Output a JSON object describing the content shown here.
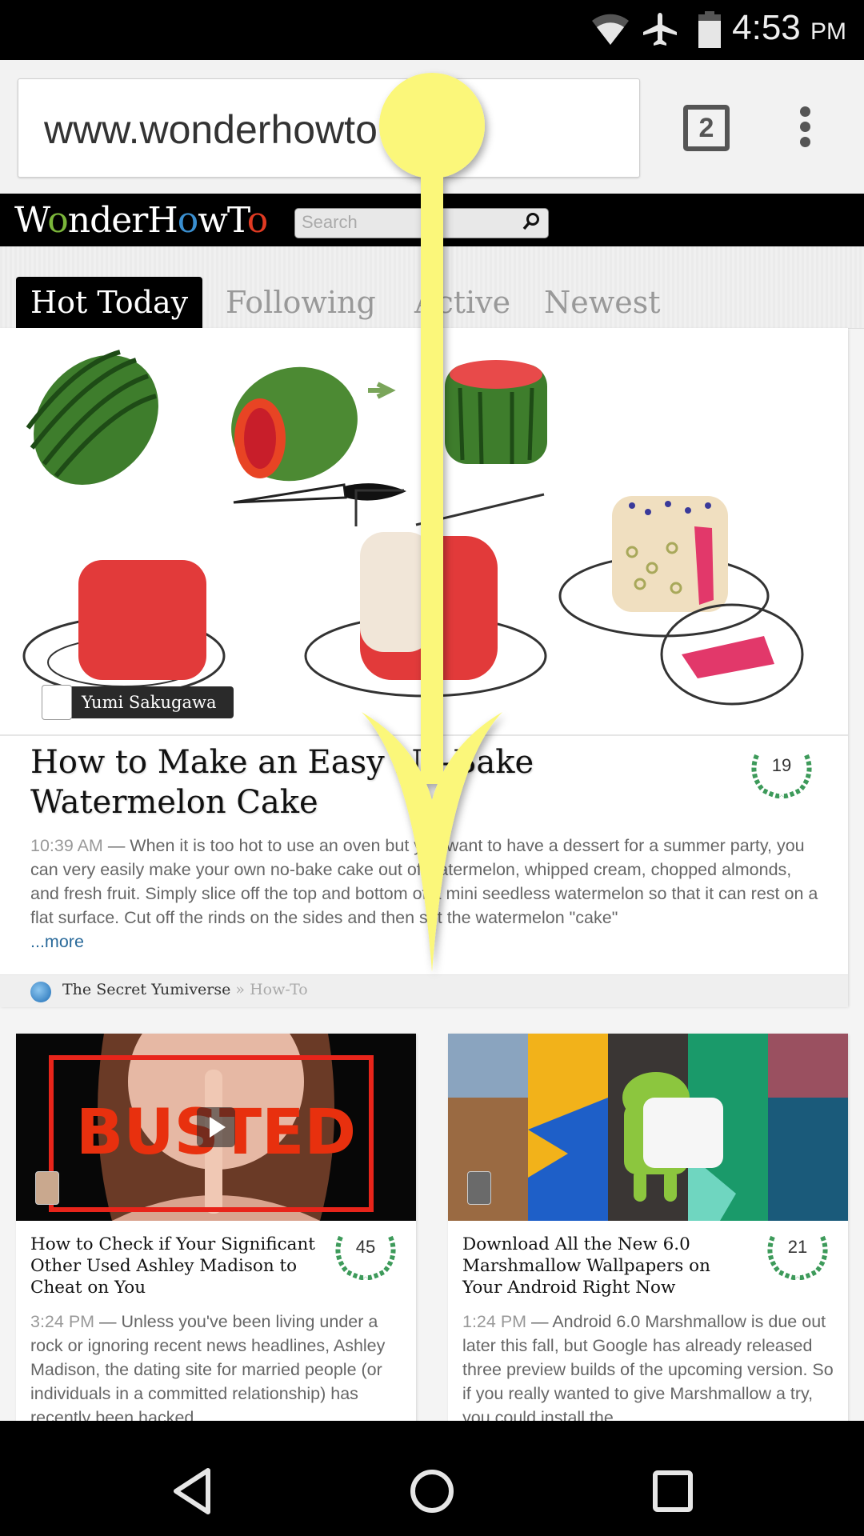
{
  "status_bar": {
    "time": "4:53",
    "ampm": "PM",
    "icons": [
      "wifi-icon",
      "airplane-mode-icon",
      "battery-icon"
    ]
  },
  "browser": {
    "url": "www.wonderhowto",
    "tab_count": "2",
    "menu_icon": "overflow-menu-icon"
  },
  "site": {
    "logo": {
      "w": "W",
      "o1": "o",
      "nderH": "nderH",
      "o2": "o",
      "wT": "wT",
      "o3": "o"
    },
    "search_placeholder": "Search",
    "tabs": [
      {
        "label": "Hot Today",
        "active": true
      },
      {
        "label": "Following",
        "active": false
      },
      {
        "label": "Active",
        "active": false
      },
      {
        "label": "Newest",
        "active": false
      }
    ]
  },
  "hero_article": {
    "author": "Yumi Sakugawa",
    "title": "How to Make an Easy No-Bake Watermelon Cake",
    "score": "19",
    "timestamp": "10:39 AM",
    "excerpt": " — When it is too hot to use an oven but you want to have a dessert for a summer party, you can very easily make your own no-bake cake out of watermelon, whipped cream, chopped almonds, and fresh fruit. Simply slice off the top and bottom of a mini seedless watermelon so that it can rest on a flat surface. Cut off the rinds on the sides and then set the watermelon \"cake\"",
    "more_link": "...more",
    "source": "The Secret Yumiverse",
    "category": " » How-To"
  },
  "cards": [
    {
      "title": "How to Check if Your Significant Other Used Ashley Madison to Cheat on You",
      "score": "45",
      "timestamp": "3:24 PM",
      "excerpt": " — Unless you've been living under a rock or ignoring recent news headlines, Ashley Madison, the dating site for married people (or individuals in a committed relationship) has recently been hacked",
      "image_text": "BUSTED"
    },
    {
      "title": "Download All the New 6.0 Marshmallow Wallpapers on Your Android Right Now",
      "score": "21",
      "timestamp": "1:24 PM",
      "excerpt": " — Android 6.0 Marshmallow is due out later this fall, but Google has already released three preview builds of the upcoming version. So if you really wanted to give Marshmallow a try, you could install the"
    }
  ],
  "gesture": {
    "type": "swipe-down",
    "color": "#fbf77a"
  },
  "nav_bar": [
    "back-icon",
    "home-icon",
    "recents-icon"
  ],
  "colors": {
    "laurel_green": "#3d9a5a",
    "header_black": "#000000",
    "link_blue": "#2a6a9a"
  }
}
